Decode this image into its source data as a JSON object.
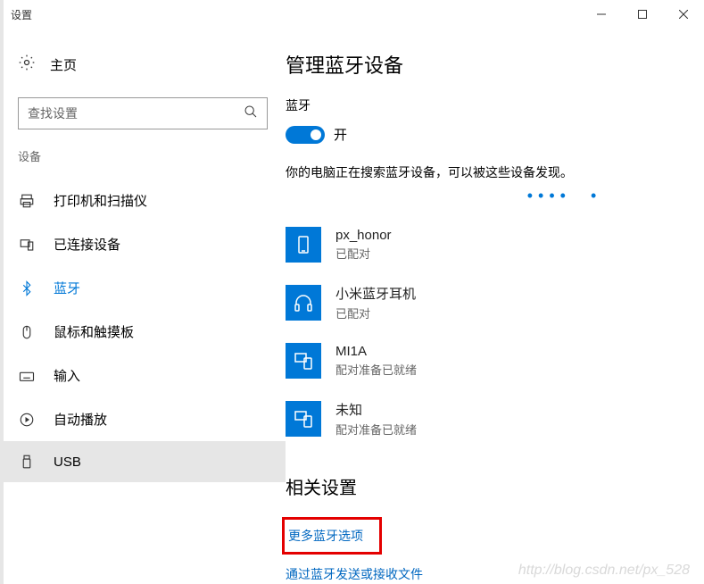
{
  "window": {
    "title": "设置"
  },
  "sidebar": {
    "home_label": "主页",
    "search_placeholder": "查找设置",
    "category_label": "设备",
    "items": [
      {
        "label": "打印机和扫描仪",
        "icon": "printer-icon"
      },
      {
        "label": "已连接设备",
        "icon": "device-icon"
      },
      {
        "label": "蓝牙",
        "icon": "bluetooth-icon",
        "active": true
      },
      {
        "label": "鼠标和触摸板",
        "icon": "mouse-icon"
      },
      {
        "label": "输入",
        "icon": "keyboard-icon"
      },
      {
        "label": "自动播放",
        "icon": "autoplay-icon"
      },
      {
        "label": "USB",
        "icon": "usb-icon",
        "selected": true
      }
    ]
  },
  "content": {
    "heading": "管理蓝牙设备",
    "bt_label": "蓝牙",
    "toggle_state": "开",
    "status_text": "你的电脑正在搜索蓝牙设备，可以被这些设备发现。",
    "devices": [
      {
        "name": "px_honor",
        "status": "已配对",
        "icon": "phone-icon"
      },
      {
        "name": "小米蓝牙耳机",
        "status": "已配对",
        "icon": "headset-icon"
      },
      {
        "name": "MI1A",
        "status": "配对准备已就绪",
        "icon": "phone-pc-icon"
      },
      {
        "name": "未知",
        "status": "配对准备已就绪",
        "icon": "phone-pc-icon"
      }
    ],
    "related_heading": "相关设置",
    "links": [
      {
        "label": "更多蓝牙选项",
        "highlighted": true
      },
      {
        "label": "通过蓝牙发送或接收文件"
      }
    ]
  },
  "watermark": "http://blog.csdn.net/px_528"
}
